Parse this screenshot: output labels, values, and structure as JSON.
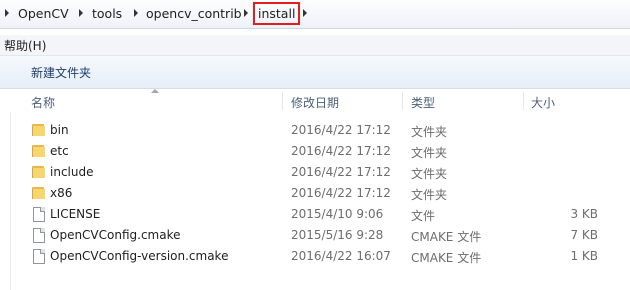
{
  "breadcrumb": {
    "items": [
      "OpenCV",
      "tools",
      "opencv_contrib",
      "install"
    ]
  },
  "menu": {
    "help": "帮助(H)"
  },
  "toolbar": {
    "new_folder": "新建文件夹"
  },
  "columns": {
    "name": "名称",
    "date": "修改日期",
    "type": "类型",
    "size": "大小"
  },
  "files": [
    {
      "name": "bin",
      "date": "2016/4/22 17:12",
      "type": "文件夹",
      "size": "",
      "icon": "folder-icon"
    },
    {
      "name": "etc",
      "date": "2016/4/22 17:12",
      "type": "文件夹",
      "size": "",
      "icon": "folder-icon"
    },
    {
      "name": "include",
      "date": "2016/4/22 17:12",
      "type": "文件夹",
      "size": "",
      "icon": "folder-icon"
    },
    {
      "name": "x86",
      "date": "2016/4/22 17:12",
      "type": "文件夹",
      "size": "",
      "icon": "folder-icon"
    },
    {
      "name": "LICENSE",
      "date": "2015/4/10 9:06",
      "type": "文件",
      "size": "3 KB",
      "icon": "file-icon"
    },
    {
      "name": "OpenCVConfig.cmake",
      "date": "2015/5/16 9:28",
      "type": "CMAKE 文件",
      "size": "7 KB",
      "icon": "file-icon"
    },
    {
      "name": "OpenCVConfig-version.cmake",
      "date": "2016/4/22 16:07",
      "type": "CMAKE 文件",
      "size": "1 KB",
      "icon": "file-icon"
    }
  ],
  "colors": {
    "highlight_border": "#e21e1e",
    "folder": "#f6d66f"
  }
}
